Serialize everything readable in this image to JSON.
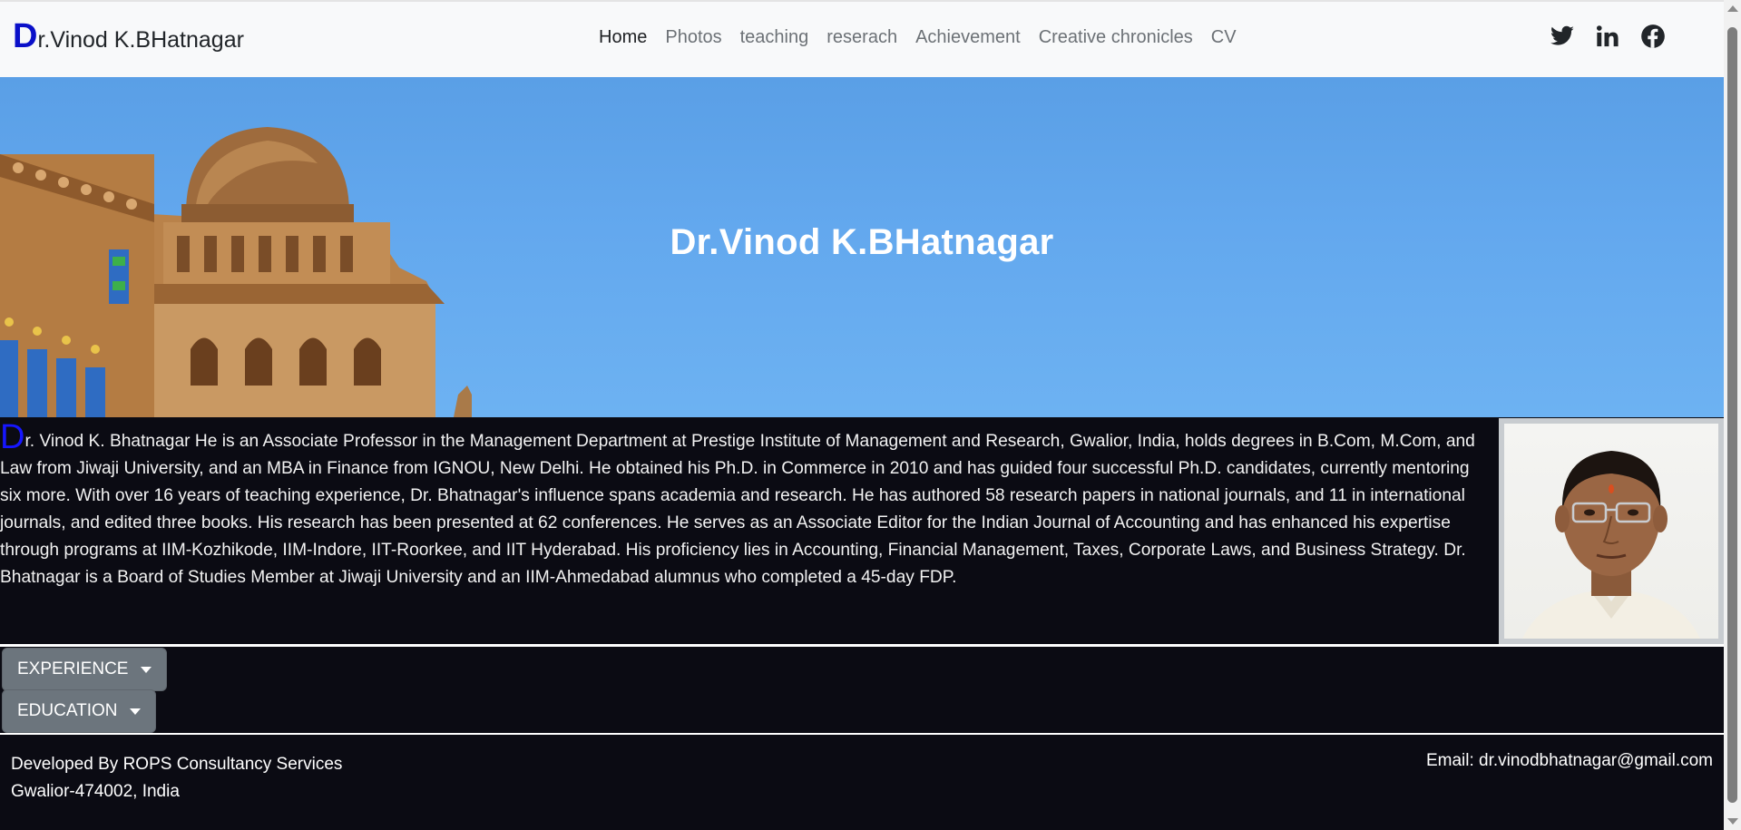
{
  "navbar": {
    "brand_cap": "D",
    "brand_rest": "r.Vinod K.BHatnagar",
    "links": [
      {
        "label": "Home",
        "active": true
      },
      {
        "label": "Photos"
      },
      {
        "label": "teaching"
      },
      {
        "label": "reserach"
      },
      {
        "label": "Achievement"
      },
      {
        "label": "Creative chronicles"
      },
      {
        "label": "CV"
      }
    ],
    "social_icons": [
      "twitter-icon",
      "linkedin-icon",
      "facebook-icon"
    ]
  },
  "hero": {
    "title": "Dr.Vinod K.BHatnagar"
  },
  "about": {
    "drop_cap": "D",
    "text": "r. Vinod K. Bhatnagar He is an Associate Professor in the Management Department at Prestige Institute of Management and Research, Gwalior, India, holds degrees in B.Com, M.Com, and Law from Jiwaji University, and an MBA in Finance from IGNOU, New Delhi. He obtained his Ph.D. in Commerce in 2010 and has guided four successful Ph.D. candidates, currently mentoring six more. With over 16 years of teaching experience, Dr. Bhatnagar's influence spans academia and research. He has authored 58 research papers in national journals, and 11 in international journals, and edited three books. His research has been presented at 62 conferences. He serves as an Associate Editor for the Indian Journal of Accounting and has enhanced his expertise through programs at IIM-Kozhikode, IIM-Indore, IIT-Roorkee, and IIT Hyderabad. His proficiency lies in Accounting, Financial Management, Taxes, Corporate Laws, and Business Strategy. Dr. Bhatnagar is a Board of Studies Member at Jiwaji University and an IIM-Ahmedabad alumnus who completed a 45-day FDP."
  },
  "sections": {
    "experience_label": "EXPERIENCE",
    "education_label": "EDUCATION"
  },
  "footer": {
    "developed_by": "Developed By ROPS Consultancy Services",
    "address": "Gwalior-474002, India",
    "email": "Email: dr.vinodbhatnagar@gmail.com"
  },
  "colors": {
    "brand_accent": "#0a10c9",
    "dark_bg": "#0b0b13",
    "button_gray": "#6c757d",
    "sky_blue": "#63a8ee"
  }
}
